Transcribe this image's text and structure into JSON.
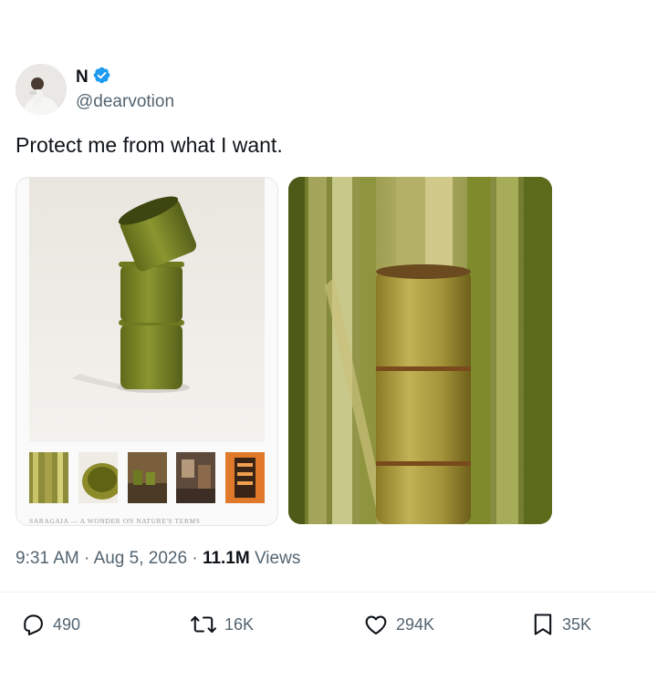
{
  "tweet": {
    "author": {
      "display_name": "N",
      "handle": "@dearvotion",
      "verified": true,
      "verified_color": "#1d9bf0"
    },
    "text": "Protect me from what I want.",
    "media": {
      "left_caption": "SARAGAIA — A WONDER ON NATURE'S TERMS"
    },
    "meta": {
      "time": "9:31 AM",
      "separator": " · ",
      "date": "Aug 5, 2026",
      "views_count": "11.1M",
      "views_label": " Views"
    },
    "actions": {
      "replies": "490",
      "reposts": "16K",
      "likes": "294K",
      "bookmarks": "35K"
    }
  },
  "icons": [
    "verified-badge-icon",
    "reply-icon",
    "repost-icon",
    "like-icon",
    "bookmark-icon"
  ]
}
